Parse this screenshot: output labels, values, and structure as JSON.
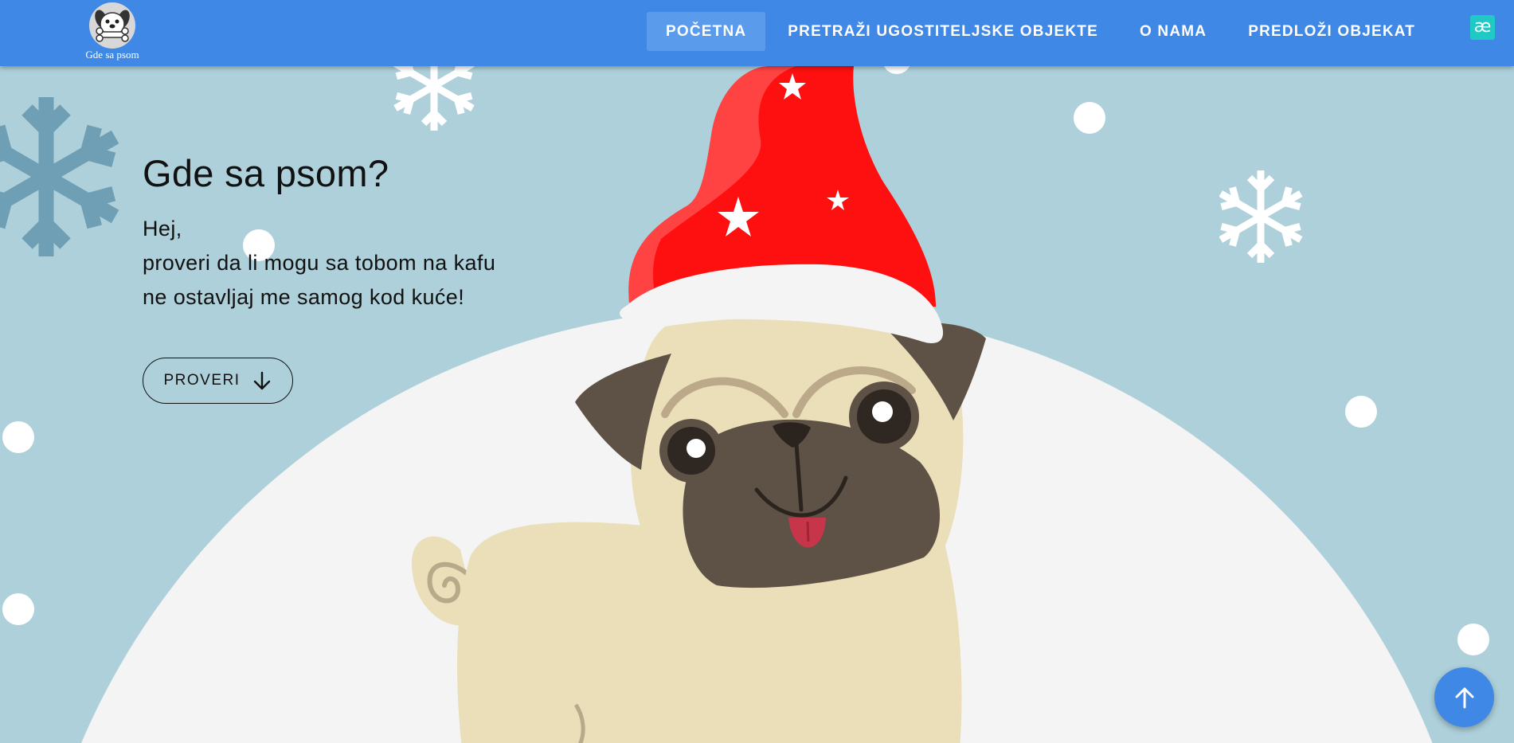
{
  "header": {
    "brand": {
      "name": "Gde sa psom",
      "logo_icon": "dog-with-bone-logo"
    },
    "nav": [
      {
        "label": "POČETNA",
        "active": true
      },
      {
        "label": "PRETRAŽI UGOSTITELJSKE OBJEKTE",
        "active": false
      },
      {
        "label": "O NAMA",
        "active": false
      },
      {
        "label": "PREDLOŽI OBJEKAT",
        "active": false
      }
    ],
    "accessibility_icon": {
      "glyph": "æ",
      "name": "accessibility-icon",
      "color": "#1fc9c5"
    }
  },
  "hero": {
    "title": "Gde sa psom?",
    "lines": [
      "Hej,",
      "proveri da li mogu sa tobom na kafu",
      "ne ostavljaj me samog kod kuće!"
    ],
    "button": {
      "label": "PROVERI",
      "icon": "arrow-down-icon"
    }
  },
  "scroll_top_button": {
    "icon": "arrow-up-icon"
  },
  "colors": {
    "header": "#3f88e5",
    "nav_active": "#5b9bec",
    "background": "#aed0da",
    "snow_hill": "#f4f4f4",
    "hat": "#ff1010",
    "pug_body": "#eadfb8",
    "pug_dark": "#5e5247"
  }
}
